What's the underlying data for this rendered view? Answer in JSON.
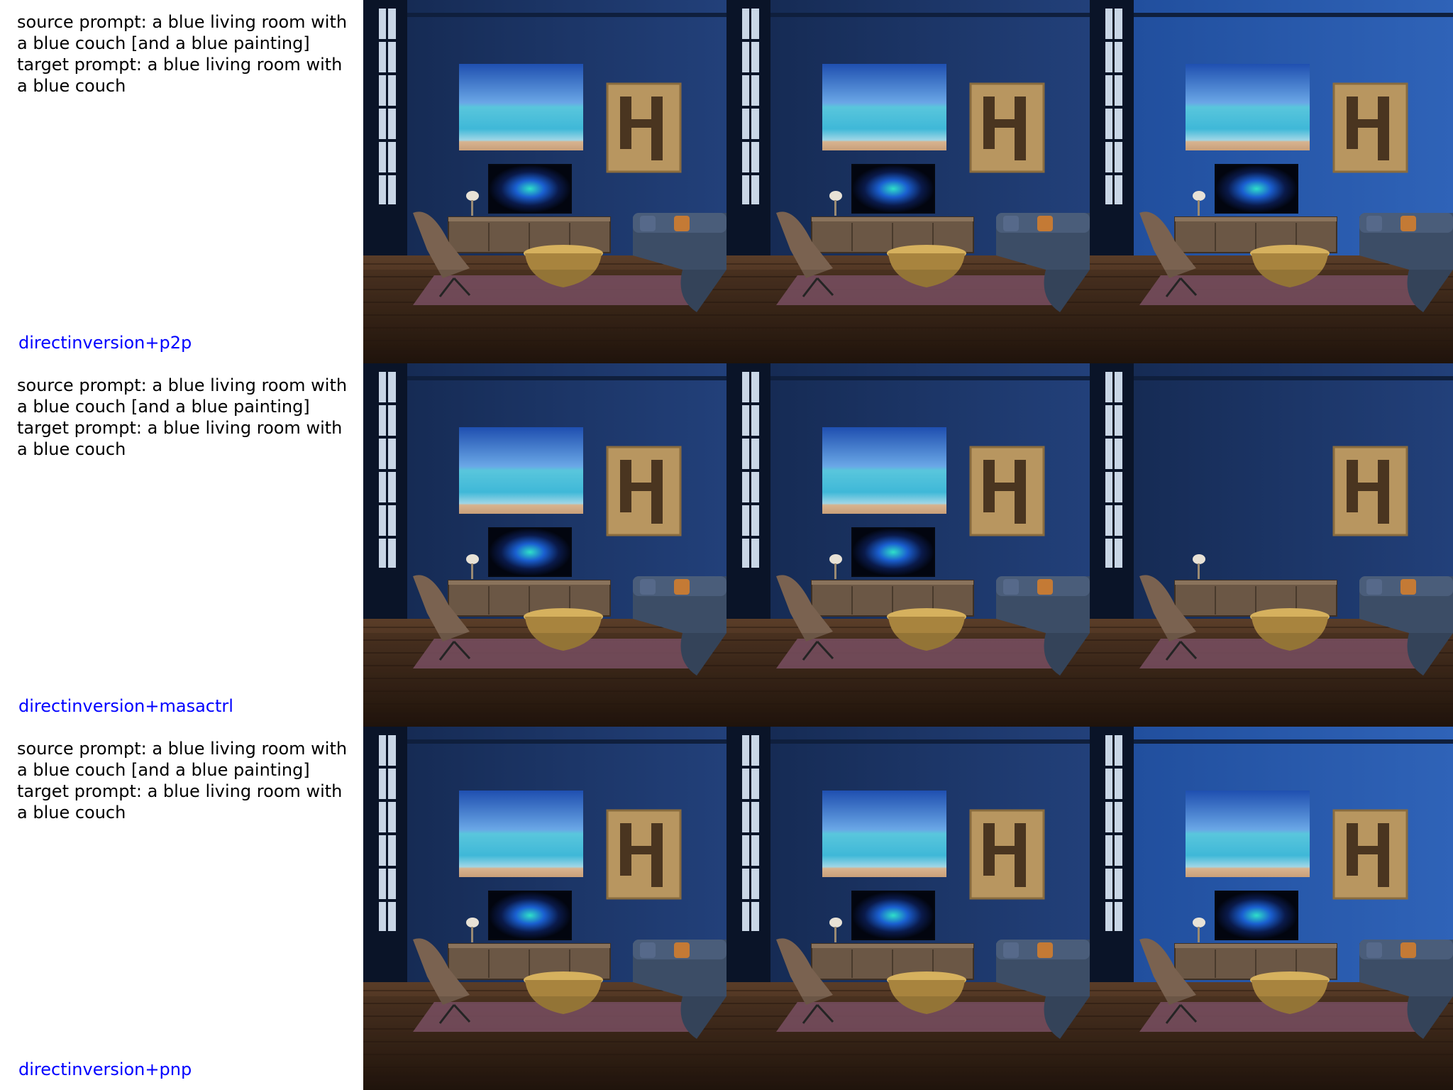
{
  "rows": [
    {
      "prompt": "source prompt: a blue living room with\na blue couch [and a blue painting]\ntarget prompt: a blue living room with\na blue couch",
      "method": "directinversion+p2p"
    },
    {
      "prompt": "source prompt: a blue living room with\na blue couch [and a blue painting]\ntarget prompt: a blue living room with\na blue couch",
      "method": "directinversion+masactrl"
    },
    {
      "prompt": "source prompt: a blue living room with\na blue couch [and a blue painting]\ntarget prompt: a blue living room with\na blue couch",
      "method": "directinversion+pnp"
    }
  ],
  "colors": {
    "method_label": "#0000ff",
    "wall": "#1d3566",
    "floor": "#4a3222",
    "rug": "#8a5a6e"
  }
}
